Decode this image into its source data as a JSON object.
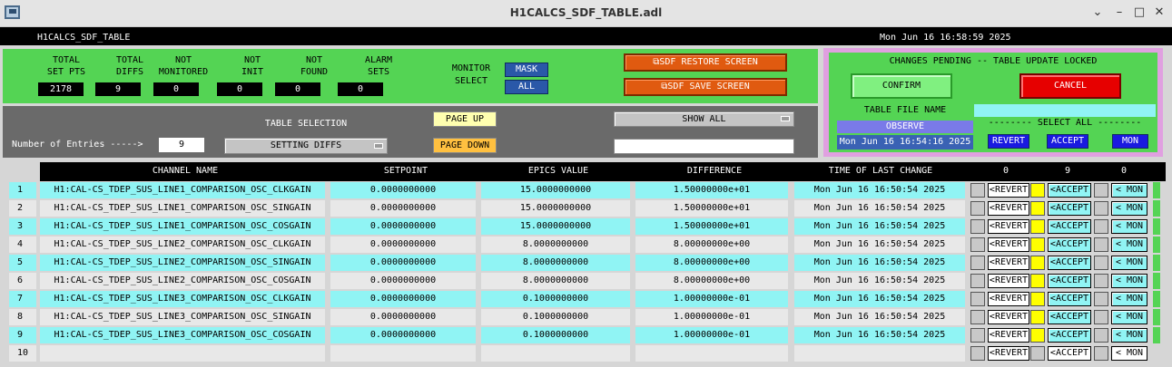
{
  "window": {
    "title": "H1CALCS_SDF_TABLE.adl"
  },
  "header": {
    "name": "H1CALCS_SDF_TABLE",
    "datetime": "Mon Jun 16 16:58:59 2025"
  },
  "stats": [
    {
      "label1": "TOTAL",
      "label2": "SET PTS",
      "value": "2178"
    },
    {
      "label1": "TOTAL",
      "label2": "DIFFS",
      "value": "9"
    },
    {
      "label1": "NOT",
      "label2": "MONITORED",
      "value": "0"
    },
    {
      "label1": "NOT",
      "label2": "INIT",
      "value": "0"
    },
    {
      "label1": "NOT",
      "label2": "FOUND",
      "value": "0"
    },
    {
      "label1": "ALARM",
      "label2": "SETS",
      "value": "0"
    }
  ],
  "monitor": {
    "label1": "MONITOR",
    "label2": "SELECT",
    "mask": "MASK",
    "all": "ALL"
  },
  "screen_buttons": {
    "restore": "SDF RESTORE SCREEN",
    "save": "SDF SAVE SCREEN"
  },
  "pending": {
    "title": "CHANGES PENDING -- TABLE UPDATE LOCKED",
    "confirm": "CONFIRM",
    "cancel": "CANCEL",
    "file_label": "TABLE FILE NAME",
    "file_value": "",
    "observe": "OBSERVE",
    "observe_time": "Mon Jun 16 16:54:16 2025",
    "select_all": "-------- SELECT ALL --------",
    "revert": "REVERT",
    "accept": "ACCEPT",
    "mon": "MON"
  },
  "table_select": {
    "label": "TABLE SELECTION",
    "entries_label": "Number of Entries ----->",
    "entries": "9",
    "selection": "SETTING DIFFS",
    "page_up": "PAGE UP",
    "page_down": "PAGE DOWN",
    "show_all": "SHOW ALL",
    "filter": ""
  },
  "columns": {
    "channel": "CHANNEL NAME",
    "setpoint": "SETPOINT",
    "epics": "EPICS VALUE",
    "difference": "DIFFERENCE",
    "time": "TIME OF LAST CHANGE",
    "count_revert": "0",
    "count_accept": "9",
    "count_mon": "0"
  },
  "row_buttons": {
    "revert": "<REVERT",
    "accept": "<ACCEPT",
    "mon": "< MON"
  },
  "rows": [
    {
      "idx": "1",
      "channel": "H1:CAL-CS_TDEP_SUS_LINE1_COMPARISON_OSC_CLKGAIN",
      "setpoint": "0.0000000000",
      "epics": "15.0000000000",
      "diff": "1.50000000e+01",
      "time": "Mon Jun 16 16:50:54 2025"
    },
    {
      "idx": "2",
      "channel": "H1:CAL-CS_TDEP_SUS_LINE1_COMPARISON_OSC_SINGAIN",
      "setpoint": "0.0000000000",
      "epics": "15.0000000000",
      "diff": "1.50000000e+01",
      "time": "Mon Jun 16 16:50:54 2025"
    },
    {
      "idx": "3",
      "channel": "H1:CAL-CS_TDEP_SUS_LINE1_COMPARISON_OSC_COSGAIN",
      "setpoint": "0.0000000000",
      "epics": "15.0000000000",
      "diff": "1.50000000e+01",
      "time": "Mon Jun 16 16:50:54 2025"
    },
    {
      "idx": "4",
      "channel": "H1:CAL-CS_TDEP_SUS_LINE2_COMPARISON_OSC_CLKGAIN",
      "setpoint": "0.0000000000",
      "epics": "8.0000000000",
      "diff": "8.00000000e+00",
      "time": "Mon Jun 16 16:50:54 2025"
    },
    {
      "idx": "5",
      "channel": "H1:CAL-CS_TDEP_SUS_LINE2_COMPARISON_OSC_SINGAIN",
      "setpoint": "0.0000000000",
      "epics": "8.0000000000",
      "diff": "8.00000000e+00",
      "time": "Mon Jun 16 16:50:54 2025"
    },
    {
      "idx": "6",
      "channel": "H1:CAL-CS_TDEP_SUS_LINE2_COMPARISON_OSC_COSGAIN",
      "setpoint": "0.0000000000",
      "epics": "8.0000000000",
      "diff": "8.00000000e+00",
      "time": "Mon Jun 16 16:50:54 2025"
    },
    {
      "idx": "7",
      "channel": "H1:CAL-CS_TDEP_SUS_LINE3_COMPARISON_OSC_CLKGAIN",
      "setpoint": "0.0000000000",
      "epics": "0.1000000000",
      "diff": "1.00000000e-01",
      "time": "Mon Jun 16 16:50:54 2025"
    },
    {
      "idx": "8",
      "channel": "H1:CAL-CS_TDEP_SUS_LINE3_COMPARISON_OSC_SINGAIN",
      "setpoint": "0.0000000000",
      "epics": "0.1000000000",
      "diff": "1.00000000e-01",
      "time": "Mon Jun 16 16:50:54 2025"
    },
    {
      "idx": "9",
      "channel": "H1:CAL-CS_TDEP_SUS_LINE3_COMPARISON_OSC_COSGAIN",
      "setpoint": "0.0000000000",
      "epics": "0.1000000000",
      "diff": "1.00000000e-01",
      "time": "Mon Jun 16 16:50:54 2025"
    },
    {
      "idx": "10",
      "channel": "",
      "setpoint": "",
      "epics": "",
      "diff": "",
      "time": ""
    }
  ],
  "colors": {
    "green": "#54d454",
    "cyan": "#90f4f4",
    "grey_row": "#e8e8e8",
    "yellow": "#ffff00",
    "red": "#e60000",
    "blue": "#2a58a8",
    "orange": "#e05a10"
  }
}
